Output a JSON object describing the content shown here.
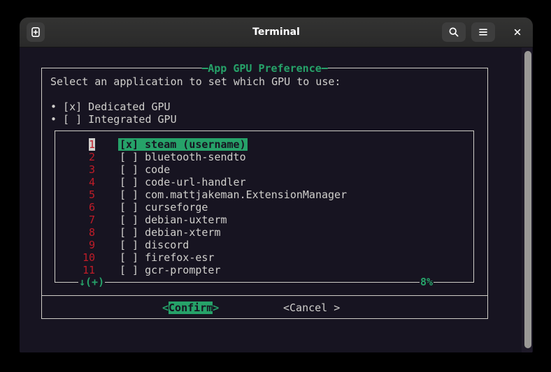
{
  "window": {
    "title": "Terminal"
  },
  "colors": {
    "terminal_bg": "#171421",
    "terminal_fg": "#d0cfcc",
    "accent_green": "#26a269",
    "number_red": "#c01c28",
    "selected_number_bg": "#d0cfcc",
    "titlebar_bg": "#2d2d2d",
    "scrollbar_thumb": "#9a9996",
    "box_border": "#cfcdc7"
  },
  "dialog": {
    "title": "App GPU Preference",
    "prompt": "Select an application to set which GPU to use:",
    "gpu_options": [
      {
        "text": "• [x] Dedicated GPU"
      },
      {
        "text": "• [ ] Integrated GPU"
      }
    ],
    "list": {
      "items": [
        {
          "number": "1",
          "box": "[x]",
          "name": "steam (username)",
          "selected": true
        },
        {
          "number": "2",
          "box": "[ ]",
          "name": "bluetooth-sendto"
        },
        {
          "number": "3",
          "box": "[ ]",
          "name": "code"
        },
        {
          "number": "4",
          "box": "[ ]",
          "name": "code-url-handler"
        },
        {
          "number": "5",
          "box": "[ ]",
          "name": "com.mattjakeman.ExtensionManager"
        },
        {
          "number": "6",
          "box": "[ ]",
          "name": "curseforge"
        },
        {
          "number": "7",
          "box": "[ ]",
          "name": "debian-uxterm"
        },
        {
          "number": "8",
          "box": "[ ]",
          "name": "debian-xterm"
        },
        {
          "number": "9",
          "box": "[ ]",
          "name": "discord"
        },
        {
          "number": "10",
          "box": "[ ]",
          "name": "firefox-esr"
        },
        {
          "number": "11",
          "box": "[ ]",
          "name": "gcr-prompter"
        }
      ],
      "more_indicator": "↓(+)",
      "scroll_percent": "8%"
    },
    "buttons": {
      "confirm": {
        "open": "<",
        "label": "Confirm",
        "close": ">"
      },
      "cancel": {
        "open": "<",
        "label": "Cancel ",
        "close": ">"
      }
    }
  }
}
